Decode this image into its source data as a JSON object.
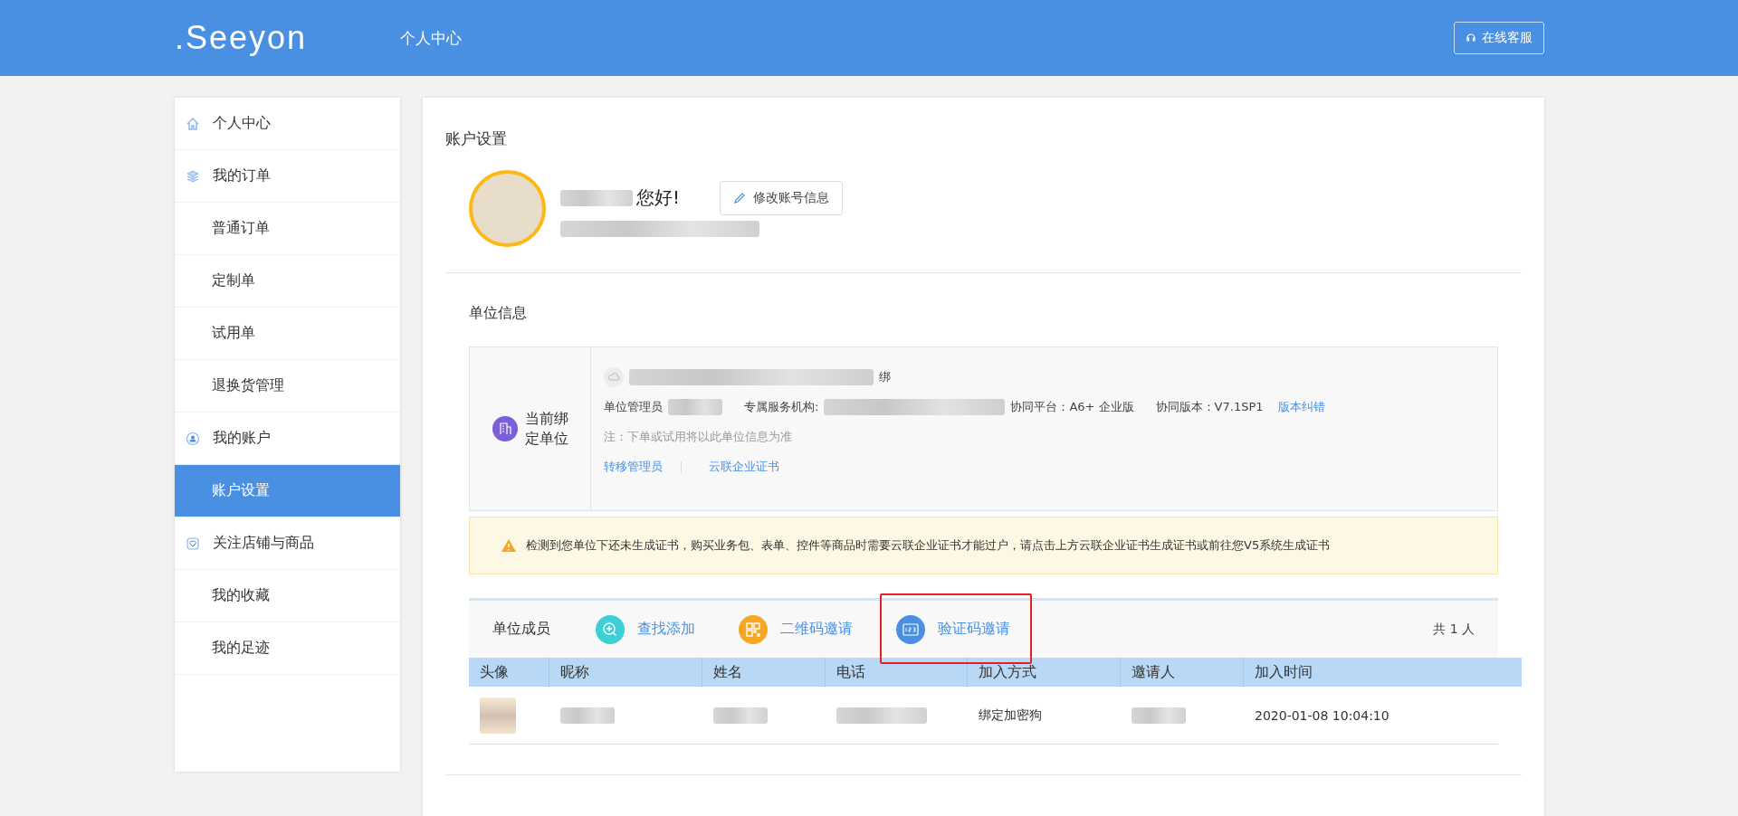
{
  "header": {
    "logo": ".Seeyon",
    "title": "个人中心",
    "service_button": "在线客服"
  },
  "sidebar": {
    "items": [
      {
        "label": "个人中心",
        "kind": "group",
        "selected": false
      },
      {
        "label": "我的订单",
        "kind": "group",
        "selected": false
      },
      {
        "label": "普通订单",
        "kind": "item",
        "selected": false
      },
      {
        "label": "定制单",
        "kind": "item",
        "selected": false
      },
      {
        "label": "试用单",
        "kind": "item",
        "selected": false
      },
      {
        "label": "退换货管理",
        "kind": "item",
        "selected": false
      },
      {
        "label": "我的账户",
        "kind": "group",
        "selected": false
      },
      {
        "label": "账户设置",
        "kind": "item",
        "selected": true
      },
      {
        "label": "关注店铺与商品",
        "kind": "group",
        "selected": false
      },
      {
        "label": "我的收藏",
        "kind": "item",
        "selected": false
      },
      {
        "label": "我的足迹",
        "kind": "item",
        "selected": false
      }
    ]
  },
  "account": {
    "title": "账户设置",
    "greeting": "您好!",
    "edit_button": "修改账号信息"
  },
  "unit": {
    "title": "单位信息",
    "bound_label": "当前绑定单位",
    "unbind": "绑",
    "admin_label": "单位管理员",
    "service_org_label": "专属服务机构:",
    "platform": "协同平台：A6+ 企业版",
    "version": "协同版本：V7.1SP1",
    "version_fix": "版本纠错",
    "note": "注：下单或试用将以此单位信息为准",
    "links": [
      "转移管理员",
      "云联企业证书"
    ]
  },
  "warning": "检测到您单位下还未生成证书，购买业务包、表单、控件等商品时需要云联企业证书才能过户，请点击上方云联企业证书生成证书或前往您V5系统生成证书",
  "members": {
    "title": "单位成员",
    "actions": [
      {
        "label": "查找添加",
        "color": "#3ccfd6",
        "highlighted": false
      },
      {
        "label": "二维码邀请",
        "color": "#f5a623",
        "highlighted": false
      },
      {
        "label": "验证码邀请",
        "color": "#4a90e2",
        "highlighted": true
      }
    ],
    "count": "共 1 人",
    "columns": [
      "头像",
      "昵称",
      "姓名",
      "电话",
      "加入方式",
      "邀请人",
      "加入时间"
    ],
    "rows": [
      {
        "join_method": "绑定加密狗",
        "join_time": "2020-01-08 10:04:10"
      }
    ]
  }
}
